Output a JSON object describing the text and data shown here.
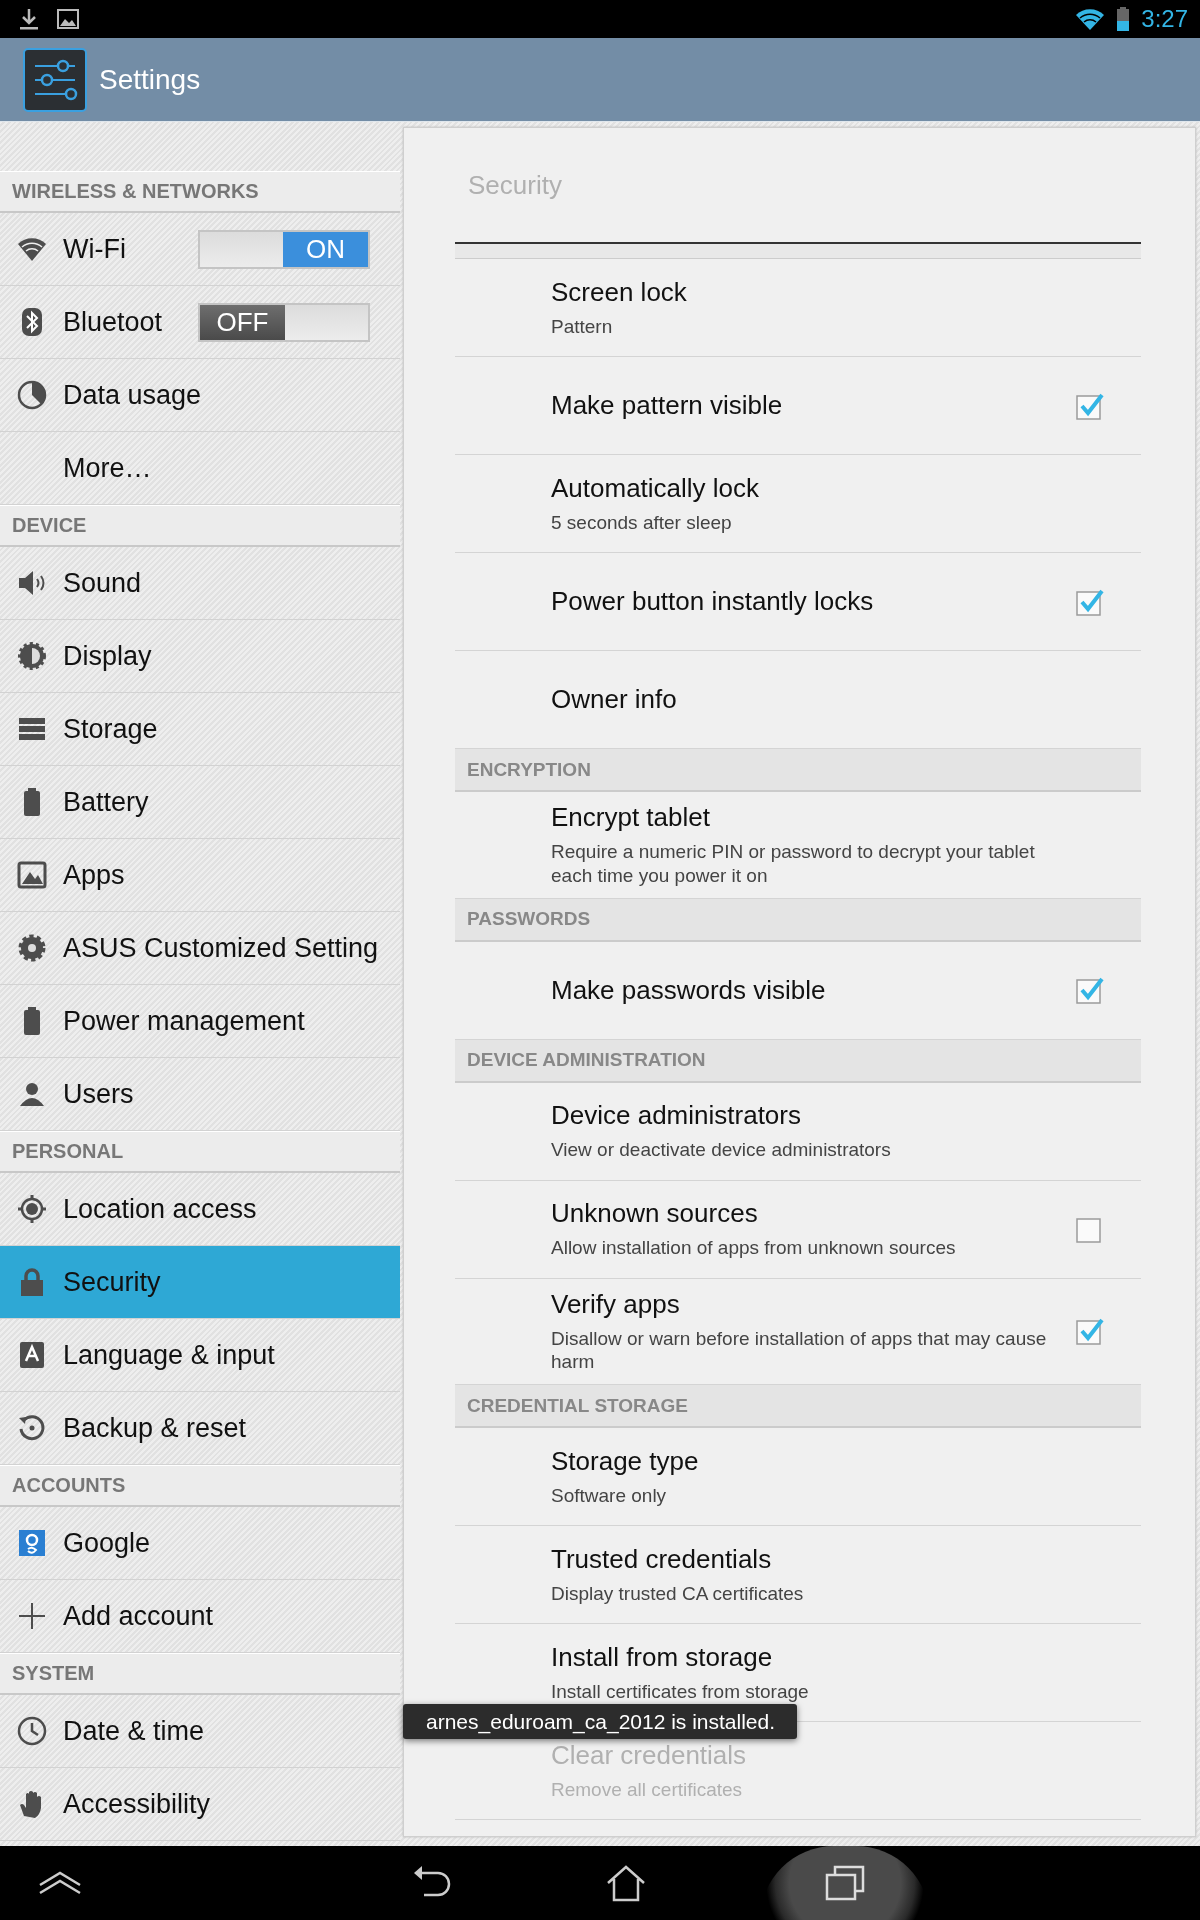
{
  "status_bar": {
    "time": "3:27"
  },
  "action_bar": {
    "title": "Settings"
  },
  "sidebar": {
    "items": [
      {
        "kind": "header",
        "label": "WIRELESS & NETWORKS"
      },
      {
        "kind": "toggle",
        "label": "Wi-Fi",
        "selected": false,
        "on": true,
        "switch_text": "ON"
      },
      {
        "kind": "toggle",
        "label": "Bluetoot",
        "selected": false,
        "on": false,
        "switch_text": "OFF"
      },
      {
        "kind": "item",
        "label": "Data usage",
        "selected": false
      },
      {
        "kind": "item",
        "label": "More…",
        "selected": false
      },
      {
        "kind": "header",
        "label": "DEVICE"
      },
      {
        "kind": "item",
        "label": "Sound",
        "selected": false
      },
      {
        "kind": "item",
        "label": "Display",
        "selected": false
      },
      {
        "kind": "item",
        "label": "Storage",
        "selected": false
      },
      {
        "kind": "item",
        "label": "Battery",
        "selected": false
      },
      {
        "kind": "item",
        "label": "Apps",
        "selected": false
      },
      {
        "kind": "item",
        "label": "ASUS Customized Setting",
        "selected": false
      },
      {
        "kind": "item",
        "label": "Power management",
        "selected": false
      },
      {
        "kind": "item",
        "label": "Users",
        "selected": false
      },
      {
        "kind": "header",
        "label": "PERSONAL"
      },
      {
        "kind": "item",
        "label": "Location access",
        "selected": false
      },
      {
        "kind": "item",
        "label": "Security",
        "selected": true
      },
      {
        "kind": "item",
        "label": "Language & input",
        "selected": false
      },
      {
        "kind": "item",
        "label": "Backup & reset",
        "selected": false
      },
      {
        "kind": "header",
        "label": "ACCOUNTS"
      },
      {
        "kind": "item",
        "label": "Google",
        "selected": false
      },
      {
        "kind": "item",
        "label": "Add account",
        "selected": false
      },
      {
        "kind": "header",
        "label": "SYSTEM"
      },
      {
        "kind": "item",
        "label": "Date & time",
        "selected": false
      },
      {
        "kind": "item",
        "label": "Accessibility",
        "selected": false
      }
    ]
  },
  "panel": {
    "title": "Security",
    "rows": [
      {
        "kind": "pref",
        "title": "Screen lock",
        "summary": "Pattern",
        "disabled": false
      },
      {
        "kind": "check",
        "title": "Make pattern visible",
        "checked": true,
        "disabled": false
      },
      {
        "kind": "pref",
        "title": "Automatically lock",
        "summary": "5 seconds after sleep",
        "disabled": false
      },
      {
        "kind": "check",
        "title": "Power button instantly locks",
        "checked": true,
        "disabled": false
      },
      {
        "kind": "pref",
        "title": "Owner info",
        "disabled": false
      },
      {
        "kind": "header",
        "label": "ENCRYPTION"
      },
      {
        "kind": "pref",
        "title": "Encrypt tablet",
        "summary": "Require a numeric PIN or password to decrypt your tablet each time you power it on",
        "disabled": false
      },
      {
        "kind": "header",
        "label": "PASSWORDS"
      },
      {
        "kind": "check",
        "title": "Make passwords visible",
        "checked": true,
        "disabled": false
      },
      {
        "kind": "header",
        "label": "DEVICE ADMINISTRATION"
      },
      {
        "kind": "pref",
        "title": "Device administrators",
        "summary": "View or deactivate device administrators",
        "disabled": false
      },
      {
        "kind": "check",
        "title": "Unknown sources",
        "summary": "Allow installation of apps from unknown sources",
        "checked": false,
        "disabled": false
      },
      {
        "kind": "check",
        "title": "Verify apps",
        "summary": "Disallow or warn before installation of apps that may cause harm",
        "checked": true,
        "disabled": false
      },
      {
        "kind": "header",
        "label": "CREDENTIAL STORAGE"
      },
      {
        "kind": "pref",
        "title": "Storage type",
        "summary": "Software only",
        "disabled": false
      },
      {
        "kind": "pref",
        "title": "Trusted credentials",
        "summary": "Display trusted CA certificates",
        "disabled": false
      },
      {
        "kind": "pref",
        "title": "Install from storage",
        "summary": "Install certificates from storage",
        "disabled": false
      },
      {
        "kind": "pref",
        "title": "Clear credentials",
        "summary": "Remove all certificates",
        "disabled": true
      }
    ]
  },
  "toast": {
    "text": "arnes_eduroam_ca_2012 is installed."
  }
}
